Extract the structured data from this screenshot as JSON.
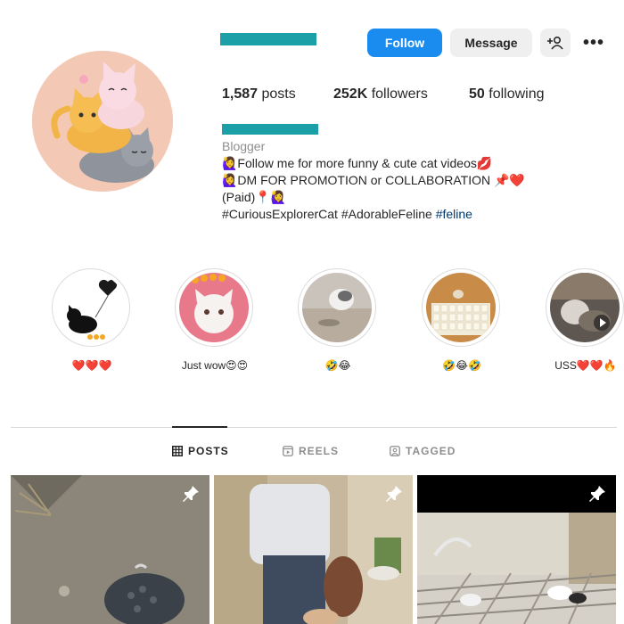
{
  "header": {
    "follow_label": "Follow",
    "message_label": "Message",
    "add_user_icon": "person-add-icon",
    "more_icon": "more-options-icon",
    "more_glyph": "•••"
  },
  "stats": {
    "posts_value": "1,587",
    "posts_label": "posts",
    "followers_value": "252K",
    "followers_label": "followers",
    "following_value": "50",
    "following_label": "following"
  },
  "bio": {
    "category": "Blogger",
    "line1": "🙋‍♀️Follow me for more funny & cute cat videos💋",
    "line2": "🙋‍♀️DM FOR PROMOTION or COLLABORATION 📌❤️",
    "line3": "(Paid)📍🙋‍♀️",
    "line4_tags": "#CuriousExplorerCat #AdorableFeline ",
    "line4_link": "#feline"
  },
  "highlights": [
    {
      "label": "❤️❤️❤️"
    },
    {
      "label": "Just wow😍😍"
    },
    {
      "label": "🤣😂"
    },
    {
      "label": "🤣😂🤣"
    },
    {
      "label": "USS❤️❤️🔥"
    }
  ],
  "tabs": {
    "posts": "POSTS",
    "reels": "REELS",
    "tagged": "TAGGED"
  },
  "colors": {
    "accent": "#1a8cf0",
    "redacted_bar": "#1aa0a6",
    "secondary_button": "#efefef",
    "muted_text": "#8e8e8e",
    "link": "#00376b"
  }
}
